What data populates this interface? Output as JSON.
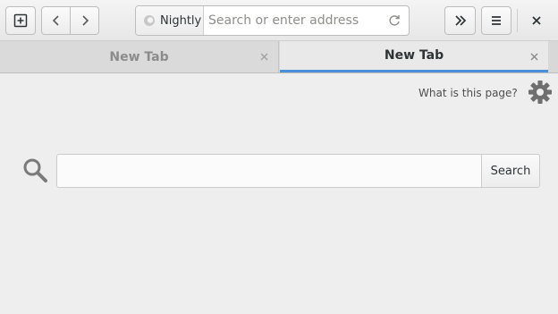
{
  "header": {
    "new_tab_icon": "new-tab-icon",
    "back_icon": "chevron-left-icon",
    "forward_icon": "chevron-right-icon",
    "identity_label": "Nightly",
    "address_placeholder": "Search or enter address",
    "address_value": "",
    "reload_icon": "reload-icon",
    "overflow_icon": "double-chevron-right-icon",
    "menu_icon": "hamburger-menu-icon",
    "close_icon": "close-icon"
  },
  "tabs": [
    {
      "label": "New Tab",
      "selected": false
    },
    {
      "label": "New Tab",
      "selected": true
    }
  ],
  "content": {
    "what_is_this_link": "What is this page?",
    "search_value": "",
    "search_button_label": "Search",
    "gear_icon": "gear-icon",
    "search_icon": "magnifier-icon"
  },
  "colors": {
    "accent": "#4a90d9",
    "background": "#eeeeee"
  }
}
